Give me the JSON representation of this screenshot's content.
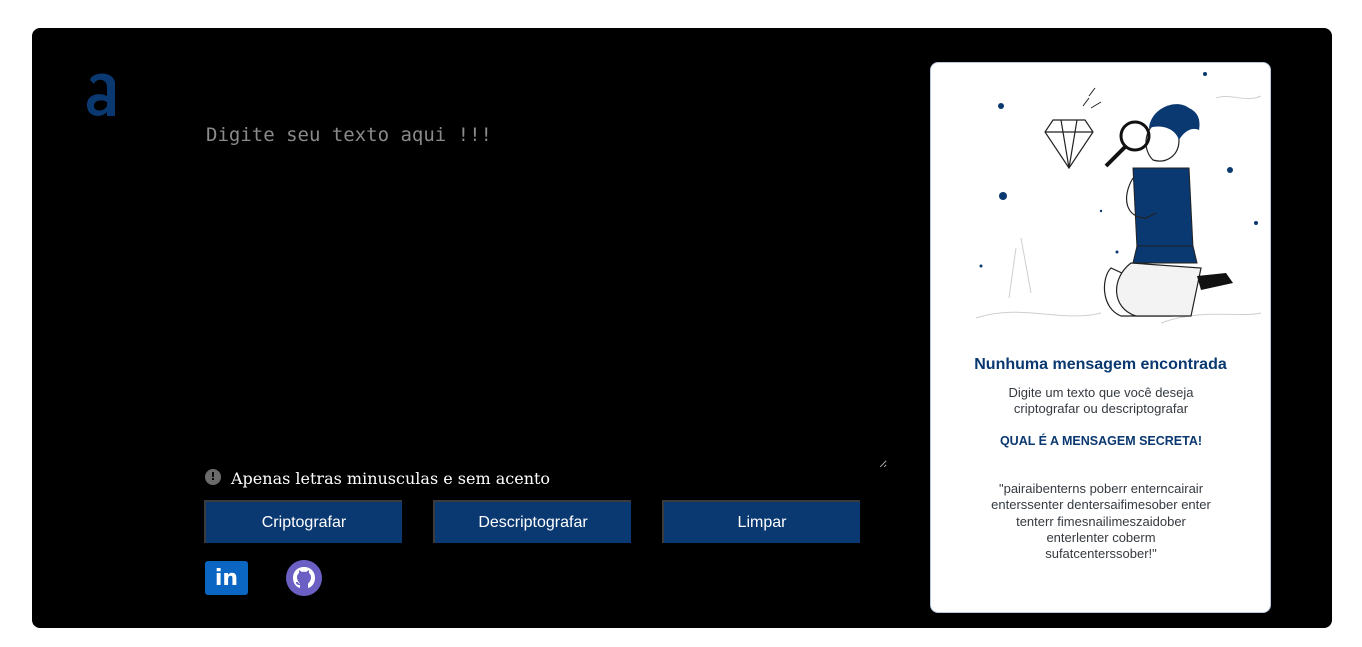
{
  "editor": {
    "placeholder": "Digite seu texto aqui !!!",
    "value": ""
  },
  "hint": {
    "icon": "exclamation-circle-icon",
    "text": "Apenas letras minusculas e sem acento"
  },
  "buttons": {
    "encrypt_label": "Criptografar",
    "decrypt_label": "Descriptografar",
    "clear_label": "Limpar"
  },
  "social": {
    "linkedin_icon": "linkedin-icon",
    "linkedin_text": "in",
    "github_icon": "github-icon"
  },
  "panel": {
    "title": "Nunhuma mensagem encontrada",
    "subtitle": "Digite um texto que você deseja criptografar ou descriptografar",
    "question": "QUAL É A MENSAGEM SECRETA!",
    "secret": "\"pairaibenterns poberr enterncairair enterssenter dentersaifimesober enter tenterr fimesnailimeszaidober enterlenter coberm sufatcenterssober!\""
  },
  "colors": {
    "accent": "#0a3871",
    "background": "#000000",
    "panel_background": "#ffffff"
  }
}
